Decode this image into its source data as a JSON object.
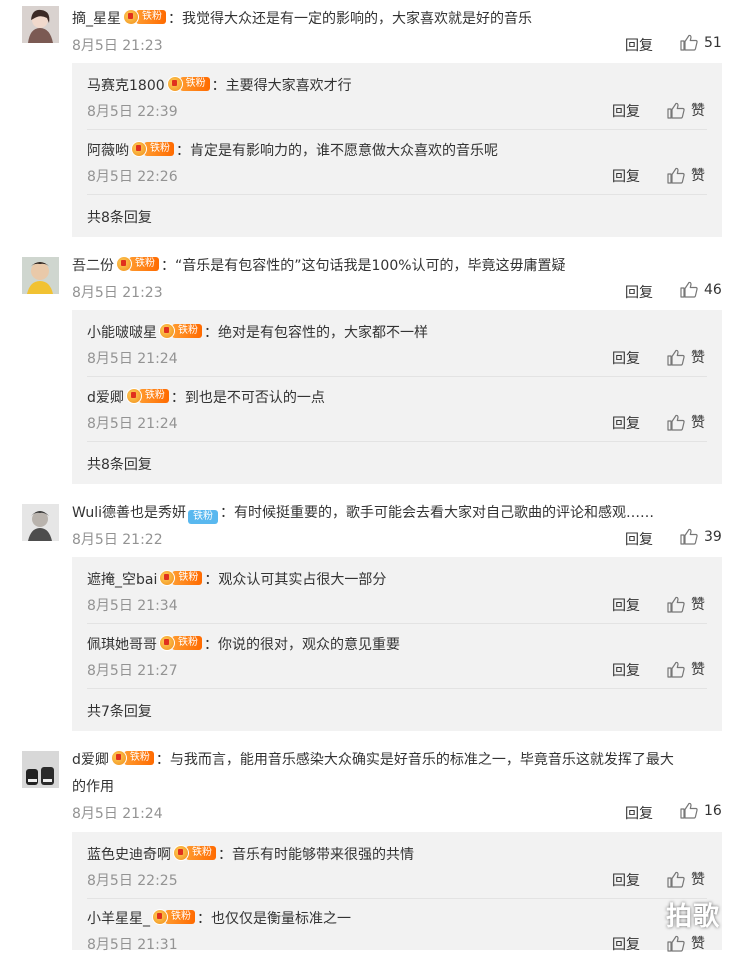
{
  "comments": [
    {
      "user": "摘_星星",
      "badge": "铁粉",
      "text": "：我觉得大众还是有一定的影响的，大家喜欢就是好的音乐",
      "time": "8月5日 21:23",
      "reply_label": "回复",
      "likes": "51",
      "replies": [
        {
          "user": "马赛克1800",
          "badge": "铁粉",
          "text": "：主要得大家喜欢才行",
          "time": "8月5日 22:39",
          "reply_label": "回复",
          "like_label": "赞"
        },
        {
          "user": "阿薇哟",
          "badge": "铁粉",
          "text": "：肯定是有影响力的，谁不愿意做大众喜欢的音乐呢",
          "time": "8月5日 22:26",
          "reply_label": "回复",
          "like_label": "赞"
        }
      ],
      "more": "共8条回复"
    },
    {
      "user": "吾二份",
      "badge": "铁粉",
      "text": "：“音乐是有包容性的”这句话我是100%认可的，毕竟这毋庸置疑",
      "time": "8月5日 21:23",
      "reply_label": "回复",
      "likes": "46",
      "replies": [
        {
          "user": "小能啵啵星",
          "badge": "铁粉",
          "text": "：绝对是有包容性的，大家都不一样",
          "time": "8月5日 21:24",
          "reply_label": "回复",
          "like_label": "赞"
        },
        {
          "user": "d爱卿",
          "badge": "铁粉",
          "text": "：到也是不可否认的一点",
          "time": "8月5日 21:24",
          "reply_label": "回复",
          "like_label": "赞"
        }
      ],
      "more": "共8条回复"
    },
    {
      "user": "Wuli德善也是秀妍",
      "badge": "铁粉",
      "text": "：有时候挺重要的，歌手可能会去看大家对自己歌曲的评论和感观……",
      "time": "8月5日 21:22",
      "reply_label": "回复",
      "likes": "39",
      "replies": [
        {
          "user": "遮掩_空bai",
          "badge": "铁粉",
          "text": "：观众认可其实占很大一部分",
          "time": "8月5日 21:34",
          "reply_label": "回复",
          "like_label": "赞"
        },
        {
          "user": "佩琪她哥哥",
          "badge": "铁粉",
          "text": "：你说的很对，观众的意见重要",
          "time": "8月5日 21:27",
          "reply_label": "回复",
          "like_label": "赞"
        }
      ],
      "more": "共7条回复"
    },
    {
      "user": "d爱卿",
      "badge": "铁粉",
      "text_line1": "：与我而言，能用音乐感染大众确实是好音乐的标准之一，毕竟音乐这就发挥了最大",
      "text_line2": "的作用",
      "time": "8月5日 21:24",
      "reply_label": "回复",
      "likes": "16",
      "replies": [
        {
          "user": "蓝色史迪奇啊",
          "badge": "铁粉",
          "text": "：音乐有时能够带来很强的共情",
          "time": "8月5日 22:25",
          "reply_label": "回复",
          "like_label": "赞"
        },
        {
          "user": "小羊星星_",
          "badge": "铁粉",
          "text": "：也仅仅是衡量标准之一",
          "time": "8月5日 21:31",
          "reply_label": "回复",
          "like_label": "赞"
        }
      ]
    }
  ],
  "watermark": "拍歌",
  "colors": {
    "meta_gray": "#939393",
    "reply_bg": "#f2f2f2",
    "badge_orange": "#ff7a12",
    "badge_blue": "#59b8ef"
  }
}
